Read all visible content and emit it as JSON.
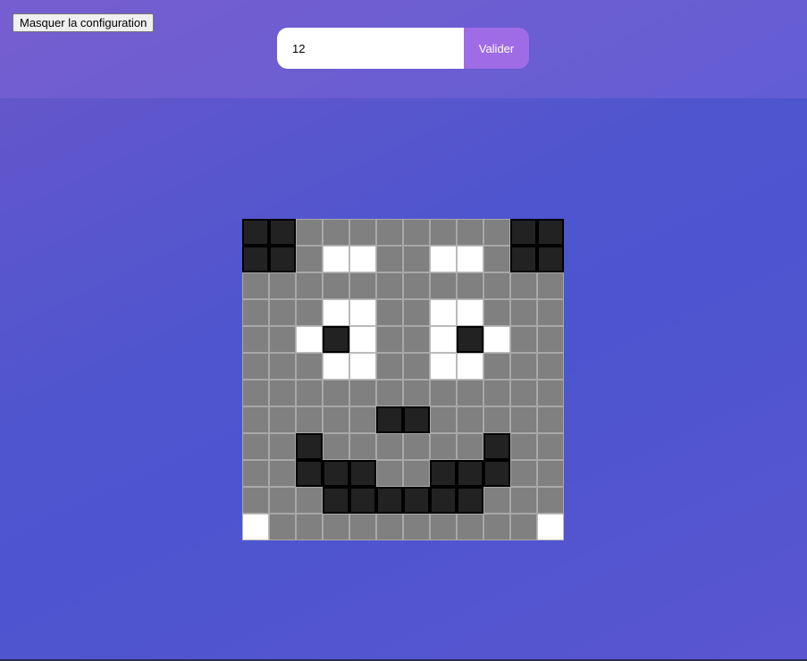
{
  "config": {
    "toggle_label": "Masquer la configuration",
    "size_value": "12",
    "submit_label": "Valider",
    "accent_color": "#9f6ce6"
  },
  "colors": {
    "gray": "#808080",
    "black": "#222222",
    "white": "#ffffff"
  },
  "grid": {
    "size": 12,
    "rows": [
      "BBGGGGGGGGBB",
      "BBGWWGGWWGBB",
      "GGGGGGGGGGGG",
      "GGGWWGGWWGGG",
      "GGWBWGGWBWGG",
      "GGGWWGGWWGGG",
      "GGGGGGGGGGGG",
      "GGGGGBBGGGGG",
      "GGBGGGGGGBGG",
      "GGBBBGGBBBGG",
      "GGGBBBBBBGGG",
      "WGGGGGGGGGGW"
    ]
  }
}
